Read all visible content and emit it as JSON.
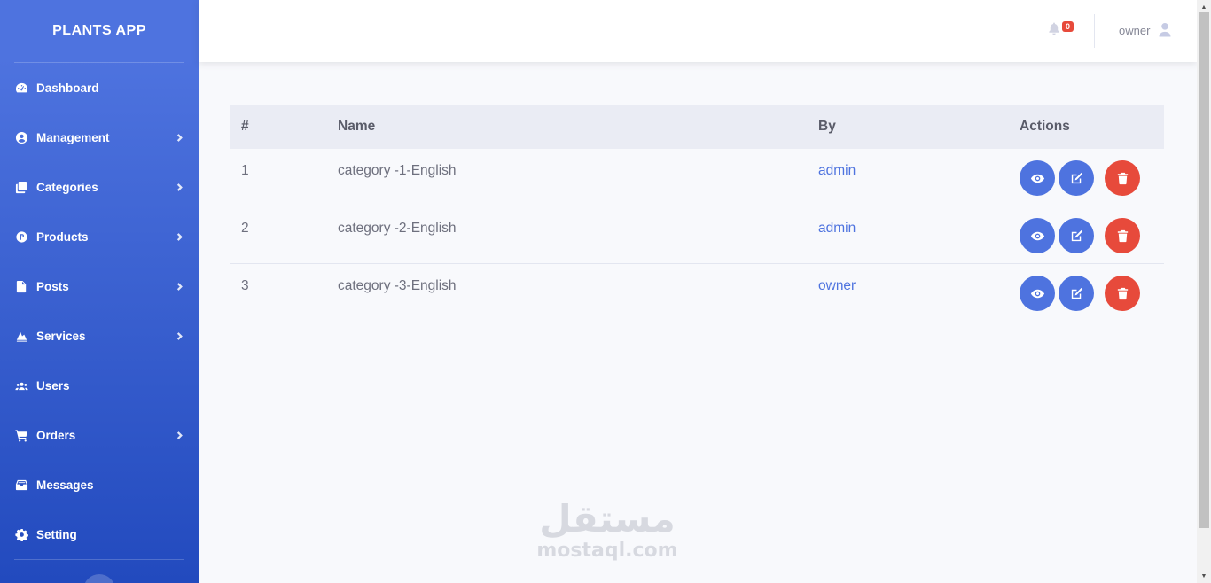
{
  "sidebar": {
    "brand": "PLANTS APP",
    "items": [
      {
        "label": "Dashboard",
        "icon": "dashboard-icon",
        "has_submenu": false
      },
      {
        "label": "Management",
        "icon": "user-circle-icon",
        "has_submenu": true
      },
      {
        "label": "Categories",
        "icon": "copy-icon",
        "has_submenu": true
      },
      {
        "label": "Products",
        "icon": "product-icon",
        "has_submenu": true
      },
      {
        "label": "Posts",
        "icon": "file-icon",
        "has_submenu": true
      },
      {
        "label": "Services",
        "icon": "services-icon",
        "has_submenu": true
      },
      {
        "label": "Users",
        "icon": "users-icon",
        "has_submenu": false
      },
      {
        "label": "Orders",
        "icon": "cart-icon",
        "has_submenu": true
      },
      {
        "label": "Messages",
        "icon": "inbox-icon",
        "has_submenu": false
      },
      {
        "label": "Setting",
        "icon": "gear-icon",
        "has_submenu": false
      }
    ]
  },
  "topbar": {
    "notification_count": "0",
    "user_name": "owner"
  },
  "table": {
    "headers": [
      "#",
      "Name",
      "By",
      "Actions"
    ],
    "rows": [
      {
        "num": "1",
        "name": "category -1-English",
        "by": "admin"
      },
      {
        "num": "2",
        "name": "category -2-English",
        "by": "admin"
      },
      {
        "num": "3",
        "name": "category -3-English",
        "by": "owner"
      }
    ]
  },
  "watermark": {
    "arabic": "مستقل",
    "latin": "mostaql.com"
  },
  "colors": {
    "primary": "#4e73df",
    "danger": "#e74a3b",
    "sidebar_dark": "#224abe",
    "background": "#f8f9fc"
  }
}
